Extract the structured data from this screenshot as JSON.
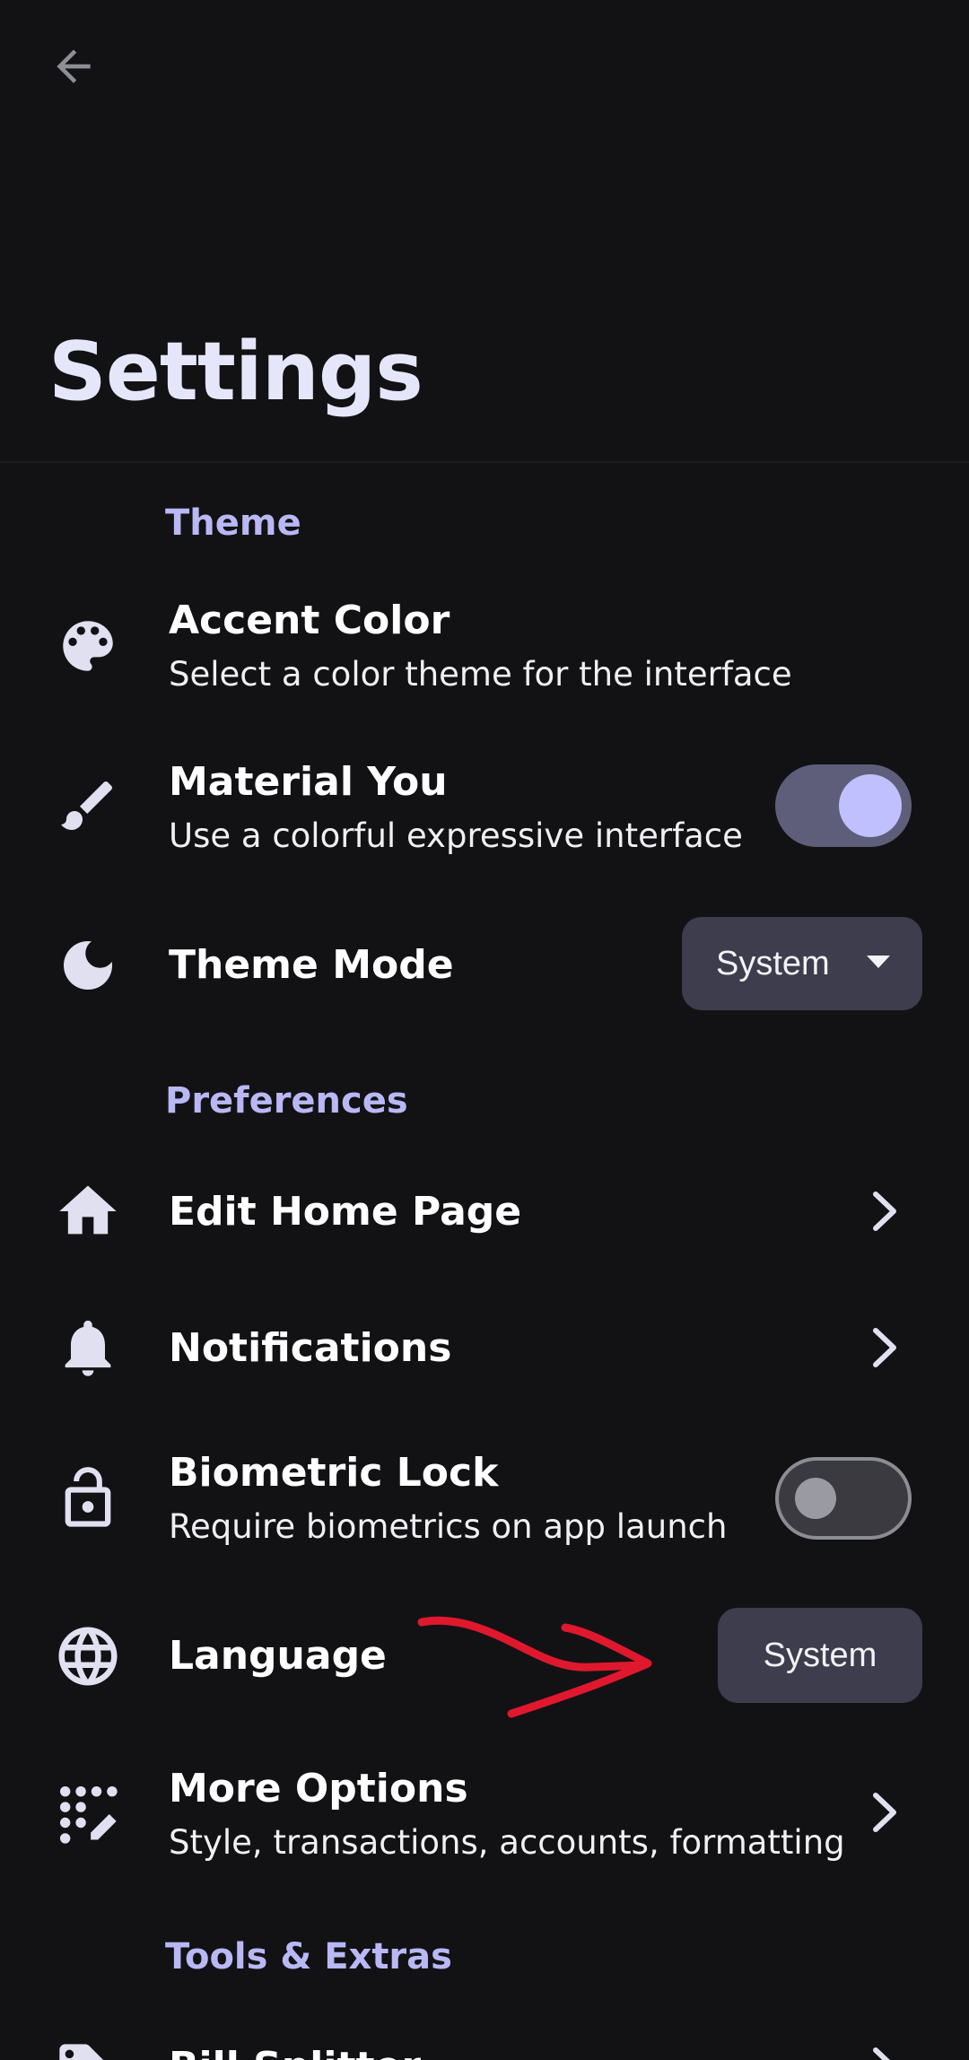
{
  "header": {
    "back_icon": "arrow-back-icon",
    "title": "Settings"
  },
  "colors": {
    "background": "#121215",
    "accent": "#b8b8f5",
    "icon": "#e0e0f0",
    "control_bg": "#3d3d4d",
    "annotation": "#e0182d"
  },
  "sections": {
    "theme": "Theme",
    "preferences": "Preferences",
    "tools": "Tools & Extras"
  },
  "accent_color": {
    "icon": "palette-icon",
    "title": "Accent Color",
    "subtitle": "Select a color theme for the interface"
  },
  "material_you": {
    "icon": "brush-icon",
    "title": "Material You",
    "subtitle": "Use a colorful expressive interface",
    "enabled": true
  },
  "theme_mode": {
    "icon": "moon-icon",
    "title": "Theme Mode",
    "value": "System"
  },
  "edit_home": {
    "icon": "home-icon",
    "title": "Edit Home Page"
  },
  "notifications": {
    "icon": "bell-icon",
    "title": "Notifications"
  },
  "biometric": {
    "icon": "lock-icon",
    "title": "Biometric Lock",
    "subtitle": "Require biometrics on app launch",
    "enabled": false
  },
  "language": {
    "icon": "globe-icon",
    "title": "Language",
    "value": "System"
  },
  "more_options": {
    "icon": "edit-dots-icon",
    "title": "More Options",
    "subtitle": "Style, transactions, accounts, formatting"
  },
  "bill_splitter": {
    "icon": "receipt-icon",
    "title": "Bill Splitter"
  }
}
